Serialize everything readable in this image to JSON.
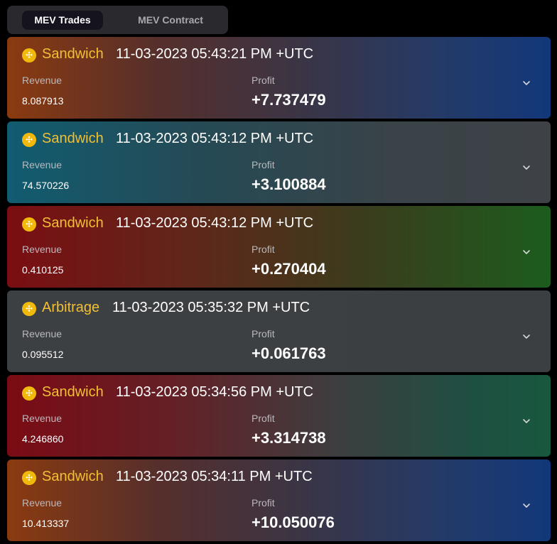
{
  "tabs": [
    {
      "label": "MEV Trades",
      "active": true
    },
    {
      "label": "MEV Contract",
      "active": false
    }
  ],
  "colors": {
    "accent_type": "#f2bf35",
    "bnb_icon": "#f0b90b",
    "background": "#000000"
  },
  "cards": [
    {
      "type": "Sandwich",
      "timestamp": "11-03-2023 05:43:21 PM +UTC",
      "revenue_label": "Revenue",
      "revenue": "8.087913",
      "profit_label": "Profit",
      "profit": "+7.737479",
      "icon": "bnb-coin-icon"
    },
    {
      "type": "Sandwich",
      "timestamp": "11-03-2023 05:43:12 PM +UTC",
      "revenue_label": "Revenue",
      "revenue": "74.570226",
      "profit_label": "Profit",
      "profit": "+3.100884",
      "icon": "bnb-coin-icon"
    },
    {
      "type": "Sandwich",
      "timestamp": "11-03-2023 05:43:12 PM +UTC",
      "revenue_label": "Revenue",
      "revenue": "0.410125",
      "profit_label": "Profit",
      "profit": "+0.270404",
      "icon": "bnb-coin-icon"
    },
    {
      "type": "Arbitrage",
      "timestamp": "11-03-2023 05:35:32 PM +UTC",
      "revenue_label": "Revenue",
      "revenue": "0.095512",
      "profit_label": "Profit",
      "profit": "+0.061763",
      "icon": "bnb-coin-icon"
    },
    {
      "type": "Sandwich",
      "timestamp": "11-03-2023 05:34:56 PM +UTC",
      "revenue_label": "Revenue",
      "revenue": "4.246860",
      "profit_label": "Profit",
      "profit": "+3.314738",
      "icon": "bnb-coin-icon"
    },
    {
      "type": "Sandwich",
      "timestamp": "11-03-2023 05:34:11 PM +UTC",
      "revenue_label": "Revenue",
      "revenue": "10.413337",
      "profit_label": "Profit",
      "profit": "+10.050076",
      "icon": "bnb-coin-icon"
    }
  ]
}
